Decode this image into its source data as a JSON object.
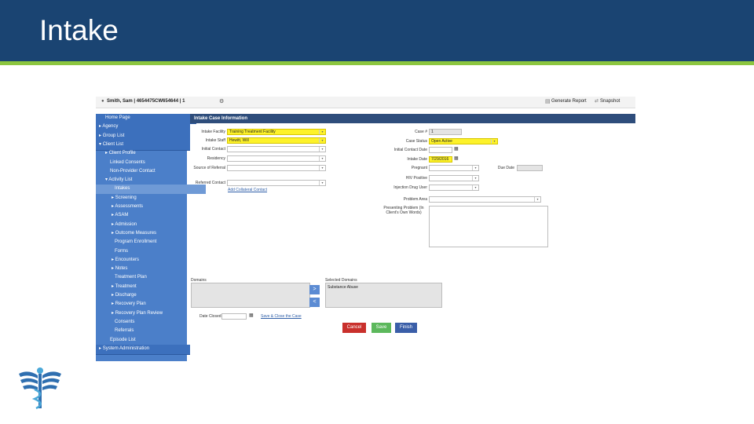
{
  "slide": {
    "title": "Intake"
  },
  "colors": {
    "header": "#1a4472",
    "accent": "#8cc63f",
    "sidebar": "#4b7fc9",
    "highlight": "#fdf22a",
    "cancel": "#c9302c",
    "save": "#5cb85c",
    "finish": "#3a5ea8"
  },
  "topbar": {
    "client": "Smith, Sam | 4654475CW654644 | 1",
    "generate_report": "Generate Report",
    "snapshot": "Snapshot"
  },
  "sidebar": {
    "items": [
      {
        "label": "Home Page",
        "prefix": ""
      },
      {
        "label": "Agency",
        "prefix": "▸"
      },
      {
        "label": "Group List",
        "prefix": "▸"
      },
      {
        "label": "Client List",
        "prefix": "▾"
      },
      {
        "label": "Client Profile",
        "prefix": "▸"
      },
      {
        "label": "Linked Consents",
        "prefix": ""
      },
      {
        "label": "Non-Provider Contact",
        "prefix": ""
      },
      {
        "label": "Activity List",
        "prefix": "▾"
      },
      {
        "label": "Intakes",
        "prefix": ""
      },
      {
        "label": "Screening",
        "prefix": "▸"
      },
      {
        "label": "Assessments",
        "prefix": "▸"
      },
      {
        "label": "ASAM",
        "prefix": "▸"
      },
      {
        "label": "Admission",
        "prefix": "▸"
      },
      {
        "label": "Outcome Measures",
        "prefix": "▸"
      },
      {
        "label": "Program Enrollment",
        "prefix": ""
      },
      {
        "label": "Forms",
        "prefix": ""
      },
      {
        "label": "Encounters",
        "prefix": "▸"
      },
      {
        "label": "Notes",
        "prefix": "▸"
      },
      {
        "label": "Treatment Plan",
        "prefix": ""
      },
      {
        "label": "Treatment",
        "prefix": "▸"
      },
      {
        "label": "Discharge",
        "prefix": "▸"
      },
      {
        "label": "Recovery Plan",
        "prefix": "▸"
      },
      {
        "label": "Recovery Plan Review",
        "prefix": "▸"
      },
      {
        "label": "Consents",
        "prefix": ""
      },
      {
        "label": "Referrals",
        "prefix": ""
      },
      {
        "label": "Episode List",
        "prefix": ""
      },
      {
        "label": "System Administration",
        "prefix": "▸"
      }
    ]
  },
  "form": {
    "panel_title": "Intake Case Information",
    "intake_facility": {
      "label": "Intake Facility",
      "value": "Training Treatment Facility"
    },
    "intake_staff": {
      "label": "Intake Staff",
      "value": "Hewitt, Will"
    },
    "initial_contact": {
      "label": "Initial Contact",
      "value": ""
    },
    "residency": {
      "label": "Residency",
      "value": ""
    },
    "source_of_referral": {
      "label": "Source of Referral",
      "value": ""
    },
    "referred_contact": {
      "label": "Referred Contact",
      "value": ""
    },
    "add_collateral": "Add Collateral Contact",
    "case_no": {
      "label": "Case #",
      "value": "1"
    },
    "case_status": {
      "label": "Case Status",
      "value": "Open Active"
    },
    "initial_contact_date": {
      "label": "Initial Contact Date",
      "value": ""
    },
    "intake_date": {
      "label": "Intake Date",
      "value": "7/29/2016"
    },
    "pregnant": {
      "label": "Pregnant",
      "value": ""
    },
    "due_date": {
      "label": "Due Date",
      "value": ""
    },
    "hiv_positive": {
      "label": "HIV Positive",
      "value": ""
    },
    "injection_drug_user": {
      "label": "Injection Drug User",
      "value": ""
    },
    "problem_area": {
      "label": "Problem Area",
      "value": ""
    },
    "presenting_problem": {
      "label": "Presenting Problem (In Client's Own Words)",
      "value": ""
    },
    "domains_label": "Domains",
    "selected_domains_label": "Selected Domains",
    "selected_domains": [
      "Substance Abuse"
    ],
    "add_arrow": ">",
    "remove_arrow": "<",
    "date_closed": {
      "label": "Date Closed",
      "value": ""
    },
    "save_close_link": "Save & Close the Case",
    "buttons": {
      "cancel": "Cancel",
      "save": "Save",
      "finish": "Finish"
    }
  }
}
